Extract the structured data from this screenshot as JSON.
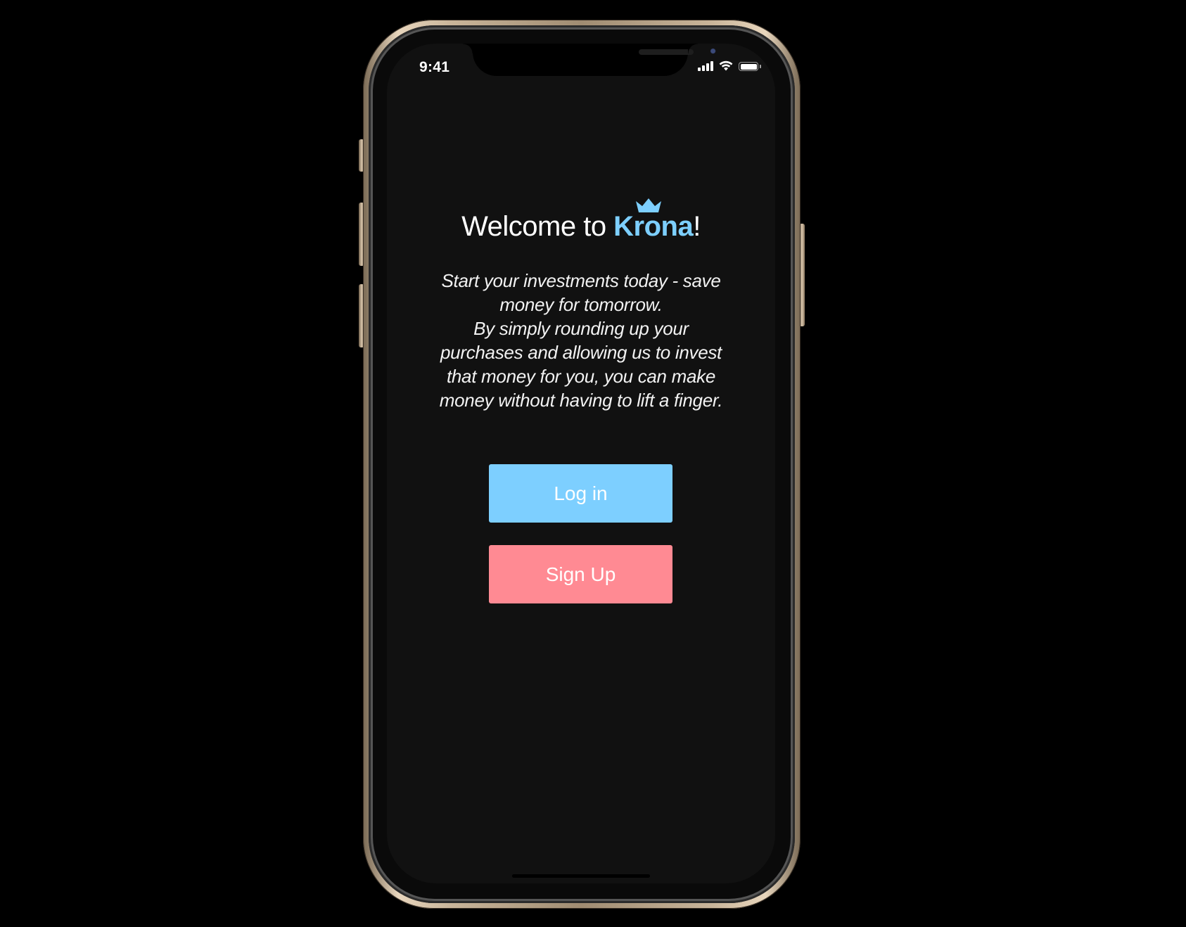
{
  "status_bar": {
    "time": "9:41",
    "icons": [
      "signal-icon",
      "wifi-icon",
      "battery-icon"
    ]
  },
  "welcome": {
    "prefix": "Welcome to ",
    "brand": "Krona",
    "suffix": "!",
    "brand_icon": "crown-icon"
  },
  "tagline": {
    "lines": [
      "Start your investments today - save",
      "money for tomorrow.",
      "By simply rounding up your",
      "purchases and allowing us to invest",
      "that money for you, you can make",
      "money without having to lift a finger."
    ]
  },
  "buttons": {
    "login_label": "Log in",
    "signup_label": "Sign Up"
  },
  "colors": {
    "background": "#111111",
    "brand_blue": "#7dcfff",
    "signup_pink": "#ff8a93",
    "text": "#ffffff"
  }
}
